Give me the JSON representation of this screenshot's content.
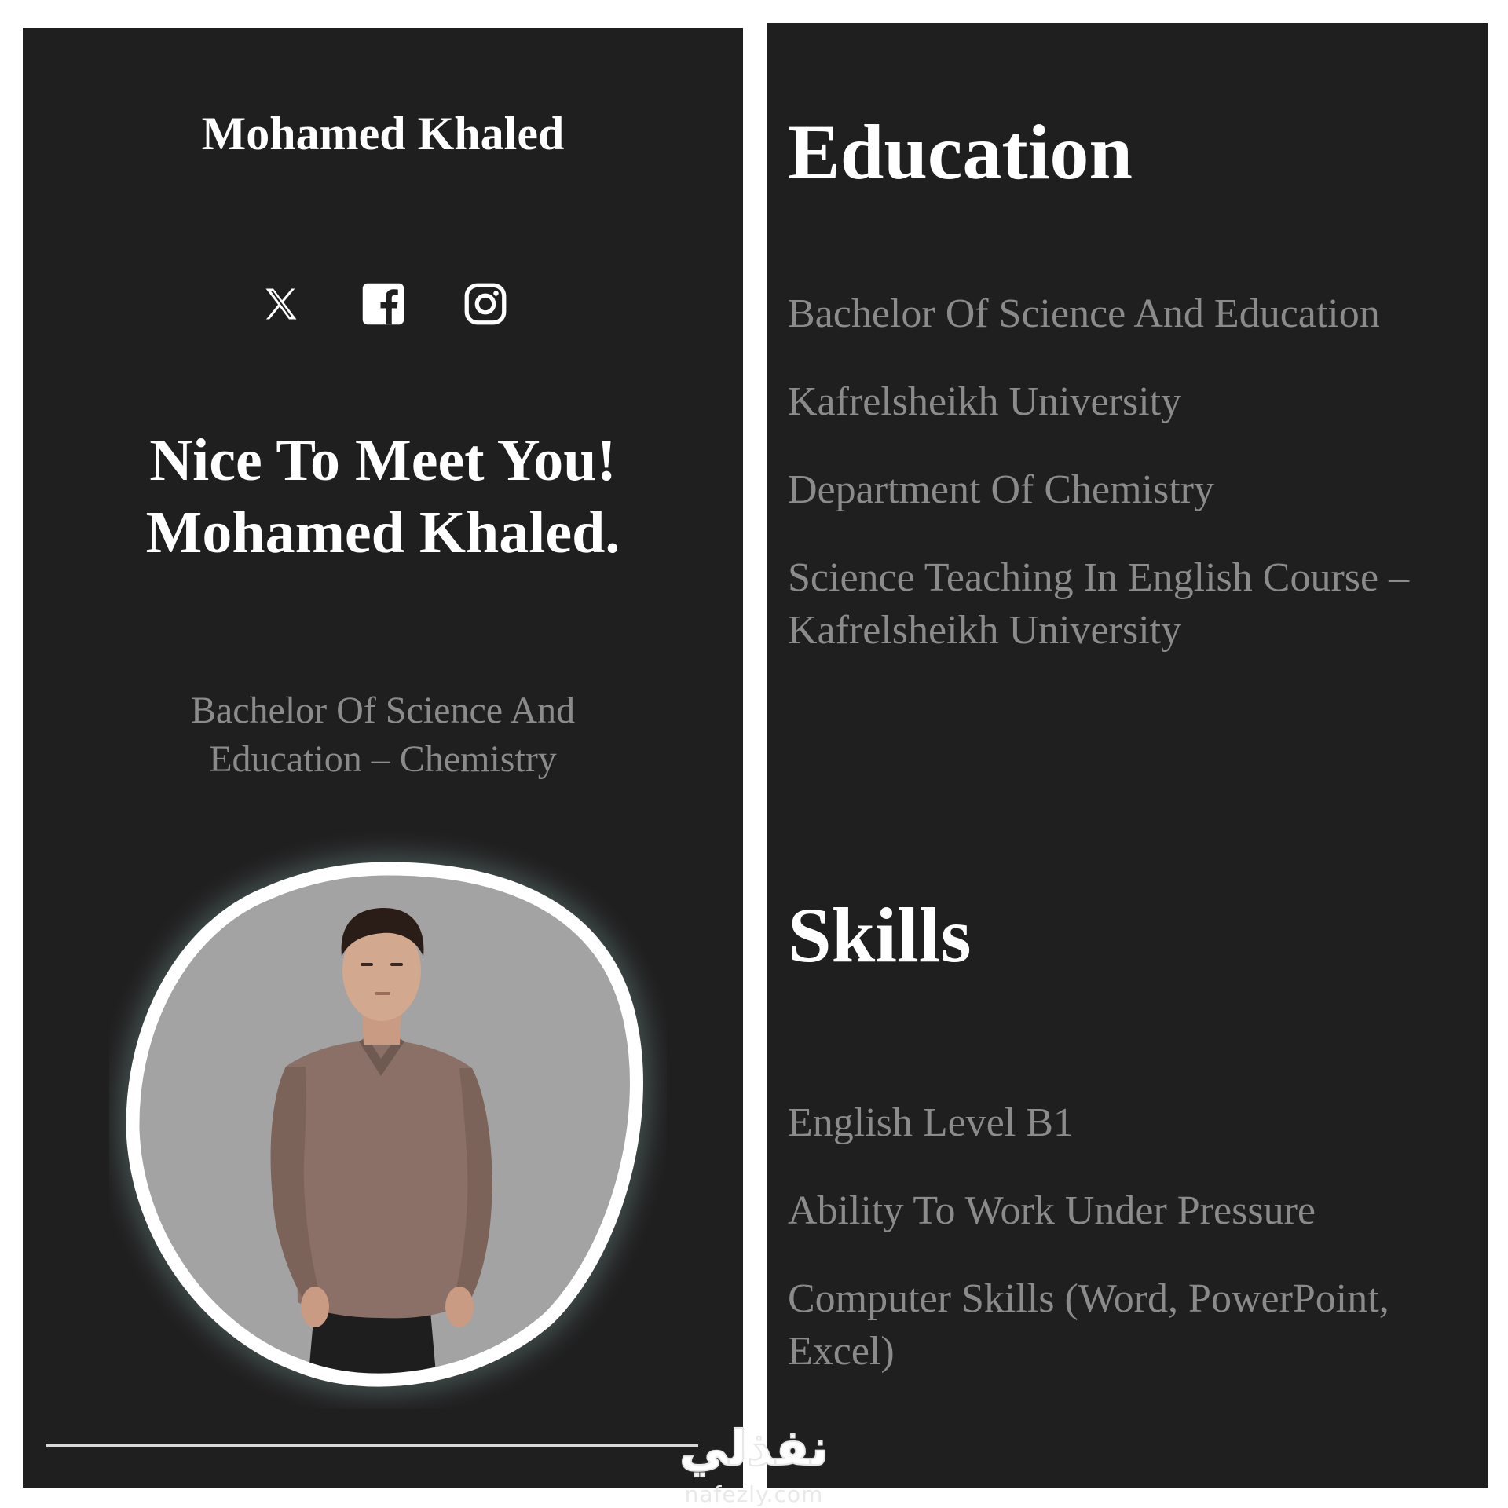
{
  "profile": {
    "site_title": "Mohamed Khaled",
    "hero_line1": "Nice To Meet You!",
    "hero_line2": "Mohamed Khaled.",
    "subtitle": "Bachelor Of Science And Education – Chemistry"
  },
  "socials": [
    {
      "icon": "x-twitter-icon"
    },
    {
      "icon": "facebook-icon"
    },
    {
      "icon": "instagram-icon"
    }
  ],
  "education": {
    "heading": "Education",
    "items": [
      "Bachelor Of Science And Education",
      "Kafrelsheikh University",
      "Department Of Chemistry",
      "Science Teaching In English Course – Kafrelsheikh University"
    ]
  },
  "skills": {
    "heading": "Skills",
    "items": [
      "English Level B1",
      "Ability To Work Under Pressure",
      "Computer Skills (Word, PowerPoint, Excel)"
    ]
  },
  "watermark": {
    "arabic": "نفذلي",
    "url": "nafezly.com"
  },
  "colors": {
    "panel_bg": "#201f20",
    "heading_text": "#ffffff",
    "body_text": "#8b8b8b",
    "photo_bg": "#a3a3a3",
    "glow": "#7fa39e"
  }
}
